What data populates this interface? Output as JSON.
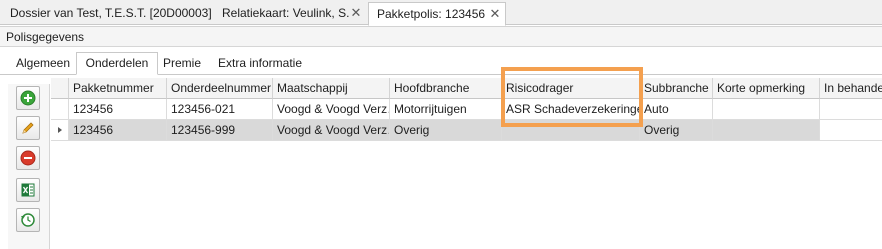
{
  "doc_tabs": [
    {
      "label": "Dossier van Test,  T.E.S.T. [20D00003]",
      "closable": false,
      "active": false
    },
    {
      "label": "Relatiekaart: Veulink, S.",
      "closable": true,
      "active": false
    },
    {
      "label": "Pakketpolis: 123456",
      "closable": true,
      "active": true
    }
  ],
  "close_glyph": "✕",
  "group": {
    "caption": "Polisgegevens"
  },
  "sub_tabs": [
    {
      "label": "Algemeen",
      "active": false
    },
    {
      "label": "Onderdelen",
      "active": true
    },
    {
      "label": "Premie",
      "active": false
    },
    {
      "label": "Extra informatie",
      "active": false
    }
  ],
  "toolbar": [
    {
      "name": "add-button",
      "icon": "plus-circle-icon",
      "color": "#3aa53a"
    },
    {
      "name": "edit-button",
      "icon": "pencil-icon",
      "color": "#e8a31c"
    },
    {
      "name": "delete-button",
      "icon": "minus-circle-icon",
      "color": "#d93b2b"
    },
    {
      "name": "export-excel-button",
      "icon": "excel-icon",
      "color": "#1f7a3a"
    },
    {
      "name": "history-button",
      "icon": "clock-arrow-icon",
      "color": "#2f8a3a"
    }
  ],
  "grid": {
    "columns": [
      "Pakketnummer",
      "Onderdeelnummer",
      "Maatschappij",
      "Hoofdbranche",
      "Risicodrager",
      "Subbranche",
      "Korte opmerking",
      "In behandel"
    ],
    "rows": [
      {
        "selected": false,
        "cells": [
          "123456",
          "123456-021",
          "Voogd & Voogd Verz…",
          "Motorrijtuigen",
          "ASR Schadeverzekeringen",
          "Auto",
          "",
          ""
        ]
      },
      {
        "selected": true,
        "cells": [
          "123456",
          "123456-999",
          "Voogd & Voogd Verz…",
          "Overig",
          "",
          "Overig",
          "",
          ""
        ]
      }
    ]
  },
  "colors": {
    "highlight": "#f4a04f",
    "selected_row": "#d9d9d9"
  }
}
